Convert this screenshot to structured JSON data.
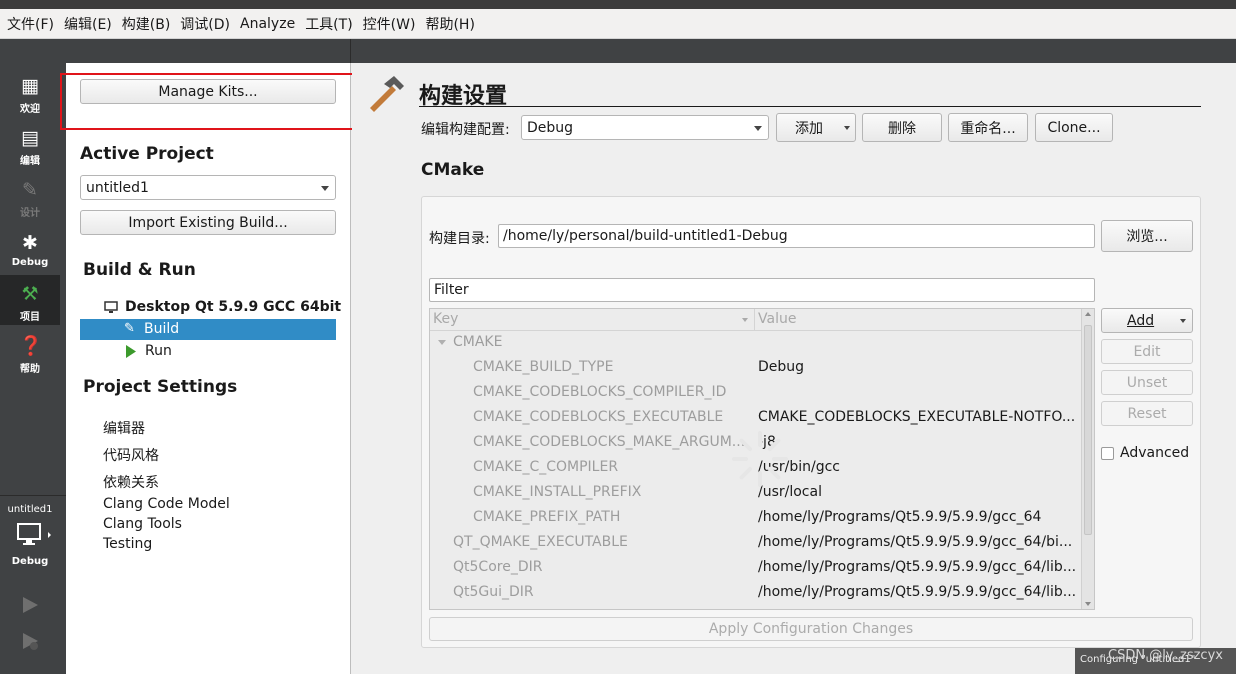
{
  "menubar": [
    "文件(F)",
    "编辑(E)",
    "构建(B)",
    "调试(D)",
    "Analyze",
    "工具(T)",
    "控件(W)",
    "帮助(H)"
  ],
  "modes": {
    "welcome": "欢迎",
    "edit": "编辑",
    "design": "设计",
    "debug": "Debug",
    "projects": "项目",
    "help": "帮助"
  },
  "project_selector": {
    "name": "untitled1",
    "config": "Debug"
  },
  "left": {
    "manage_kits": "Manage Kits...",
    "active_project_title": "Active Project",
    "active_project": "untitled1",
    "import_build": "Import Existing Build...",
    "build_run_title": "Build & Run",
    "kit": "Desktop Qt 5.9.9 GCC 64bit",
    "build": "Build",
    "run": "Run",
    "project_settings_title": "Project Settings",
    "settings": [
      "编辑器",
      "代码风格",
      "依赖关系",
      "Clang Code Model",
      "Clang Tools",
      "Testing"
    ]
  },
  "main": {
    "title": "构建设置",
    "edit_config_label": "编辑构建配置:",
    "config_value": "Debug",
    "add": "添加",
    "delete": "删除",
    "rename": "重命名...",
    "clone": "Clone...",
    "cmake_title": "CMake",
    "build_dir_label": "构建目录:",
    "build_dir": "/home/ly/personal/build-untitled1-Debug",
    "browse": "浏览...",
    "filter_placeholder": "Filter",
    "col_key": "Key",
    "col_value": "Value",
    "group": "CMAKE",
    "rows": [
      {
        "key": "CMAKE_BUILD_TYPE",
        "value": "Debug"
      },
      {
        "key": "CMAKE_CODEBLOCKS_COMPILER_ID",
        "value": ""
      },
      {
        "key": "CMAKE_CODEBLOCKS_EXECUTABLE",
        "value": "CMAKE_CODEBLOCKS_EXECUTABLE-NOTFO..."
      },
      {
        "key": "CMAKE_CODEBLOCKS_MAKE_ARGUM...",
        "value": "-j8"
      },
      {
        "key": "CMAKE_C_COMPILER",
        "value": "/usr/bin/gcc"
      },
      {
        "key": "CMAKE_INSTALL_PREFIX",
        "value": "/usr/local"
      },
      {
        "key": "CMAKE_PREFIX_PATH",
        "value": "/home/ly/Programs/Qt5.9.9/5.9.9/gcc_64"
      },
      {
        "key": "QT_QMAKE_EXECUTABLE",
        "value": "/home/ly/Programs/Qt5.9.9/5.9.9/gcc_64/bi..."
      },
      {
        "key": "Qt5Core_DIR",
        "value": "/home/ly/Programs/Qt5.9.9/5.9.9/gcc_64/lib..."
      },
      {
        "key": "Qt5Gui_DIR",
        "value": "/home/ly/Programs/Qt5.9.9/5.9.9/gcc_64/lib..."
      }
    ],
    "btn_add": "Add",
    "btn_edit": "Edit",
    "btn_unset": "Unset",
    "btn_reset": "Reset",
    "advanced": "Advanced",
    "apply": "Apply Configuration Changes",
    "status_tip": "Configuring \"untitled1\"",
    "watermark": "CSDN @ly_zszcyx"
  },
  "colors": {
    "modebar": "#404244",
    "selection": "#308cc6",
    "highlight_box": "#e0141a"
  }
}
